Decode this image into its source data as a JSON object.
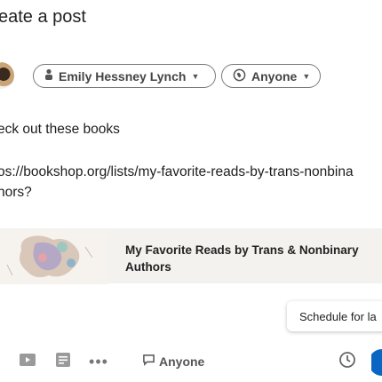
{
  "modal": {
    "title": "eate a post"
  },
  "author_chip": {
    "label": "Emily Hessney Lynch"
  },
  "visibility_chip": {
    "label": "Anyone"
  },
  "post_text": {
    "line1": "eck out these books",
    "line2": "os://bookshop.org/lists/my-favorite-reads-by-trans-nonbina",
    "line3": "hors?"
  },
  "link_preview": {
    "title_line1": "My Favorite Reads by Trans & Nonbinary",
    "title_line2": "Authors"
  },
  "tooltip": {
    "text": "Schedule for la"
  },
  "footer": {
    "visibility_label": "Anyone"
  },
  "icons": {
    "author": "person-icon",
    "visibility": "globe-icon",
    "video": "video-icon",
    "document": "document-icon",
    "more": "more-icon",
    "chat": "chat-bubble-icon",
    "schedule": "clock-icon"
  },
  "colors": {
    "accent": "#0a66c2",
    "border": "#7a7a7a",
    "card_bg": "#f3f2ef"
  }
}
